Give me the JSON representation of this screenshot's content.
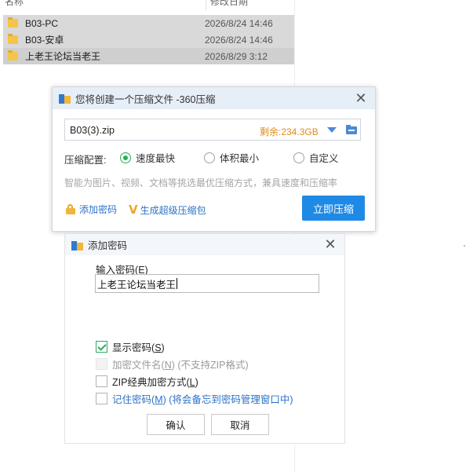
{
  "explorer": {
    "columns": {
      "name": "名称",
      "modified": "修改日期"
    },
    "files": [
      {
        "name": "B03-PC",
        "date": "2026/8/24 14:46"
      },
      {
        "name": "B03-安卓",
        "date": "2026/8/24 14:46"
      },
      {
        "name": "上老王论坛当老王",
        "date": "2026/8/29 3:12"
      }
    ]
  },
  "compress_dialog": {
    "title": "您将创建一个压缩文件 -360压缩",
    "filename": "B03(3).zip",
    "free_space": "剩余:234.3GB",
    "config_label": "压缩配置:",
    "options": [
      "速度最快",
      "体积最小",
      "自定义"
    ],
    "selected_option": "速度最快",
    "hint": "智能为图片、视频、文档等挑选最优压缩方式，兼具速度和压缩率",
    "add_password": "添加密码",
    "super_pack": "生成超级压缩包",
    "compress_now": "立即压缩"
  },
  "password_dialog": {
    "title": "添加密码",
    "input_label": "输入密码",
    "input_label_key": "E",
    "password_value": "上老王论坛当老王",
    "checkboxes": [
      {
        "label": "显示密码",
        "key": "S",
        "suffix": "",
        "checked": true,
        "disabled": false
      },
      {
        "label": "加密文件名",
        "key": "N",
        "suffix": " (不支持ZIP格式)",
        "checked": false,
        "disabled": true
      },
      {
        "label": "ZIP经典加密方式",
        "key": "L",
        "suffix": "",
        "checked": false,
        "disabled": false
      },
      {
        "label": "记住密码",
        "key": "M",
        "suffix": " (将会备忘到密码管理窗口中)",
        "checked": false,
        "disabled": false
      }
    ],
    "ok": "确认",
    "cancel": "取消"
  },
  "colors": {
    "accent_blue": "#1e8ae6",
    "radio_green": "#2cab5c",
    "free_space_orange": "#e08b1a",
    "link_blue": "#2b72c9"
  },
  "icons": [
    "folder-icon",
    "app-icon",
    "close-icon",
    "dropdown-arrow-icon",
    "browse-folder-icon",
    "lock-icon",
    "v-icon",
    "check-icon"
  ]
}
